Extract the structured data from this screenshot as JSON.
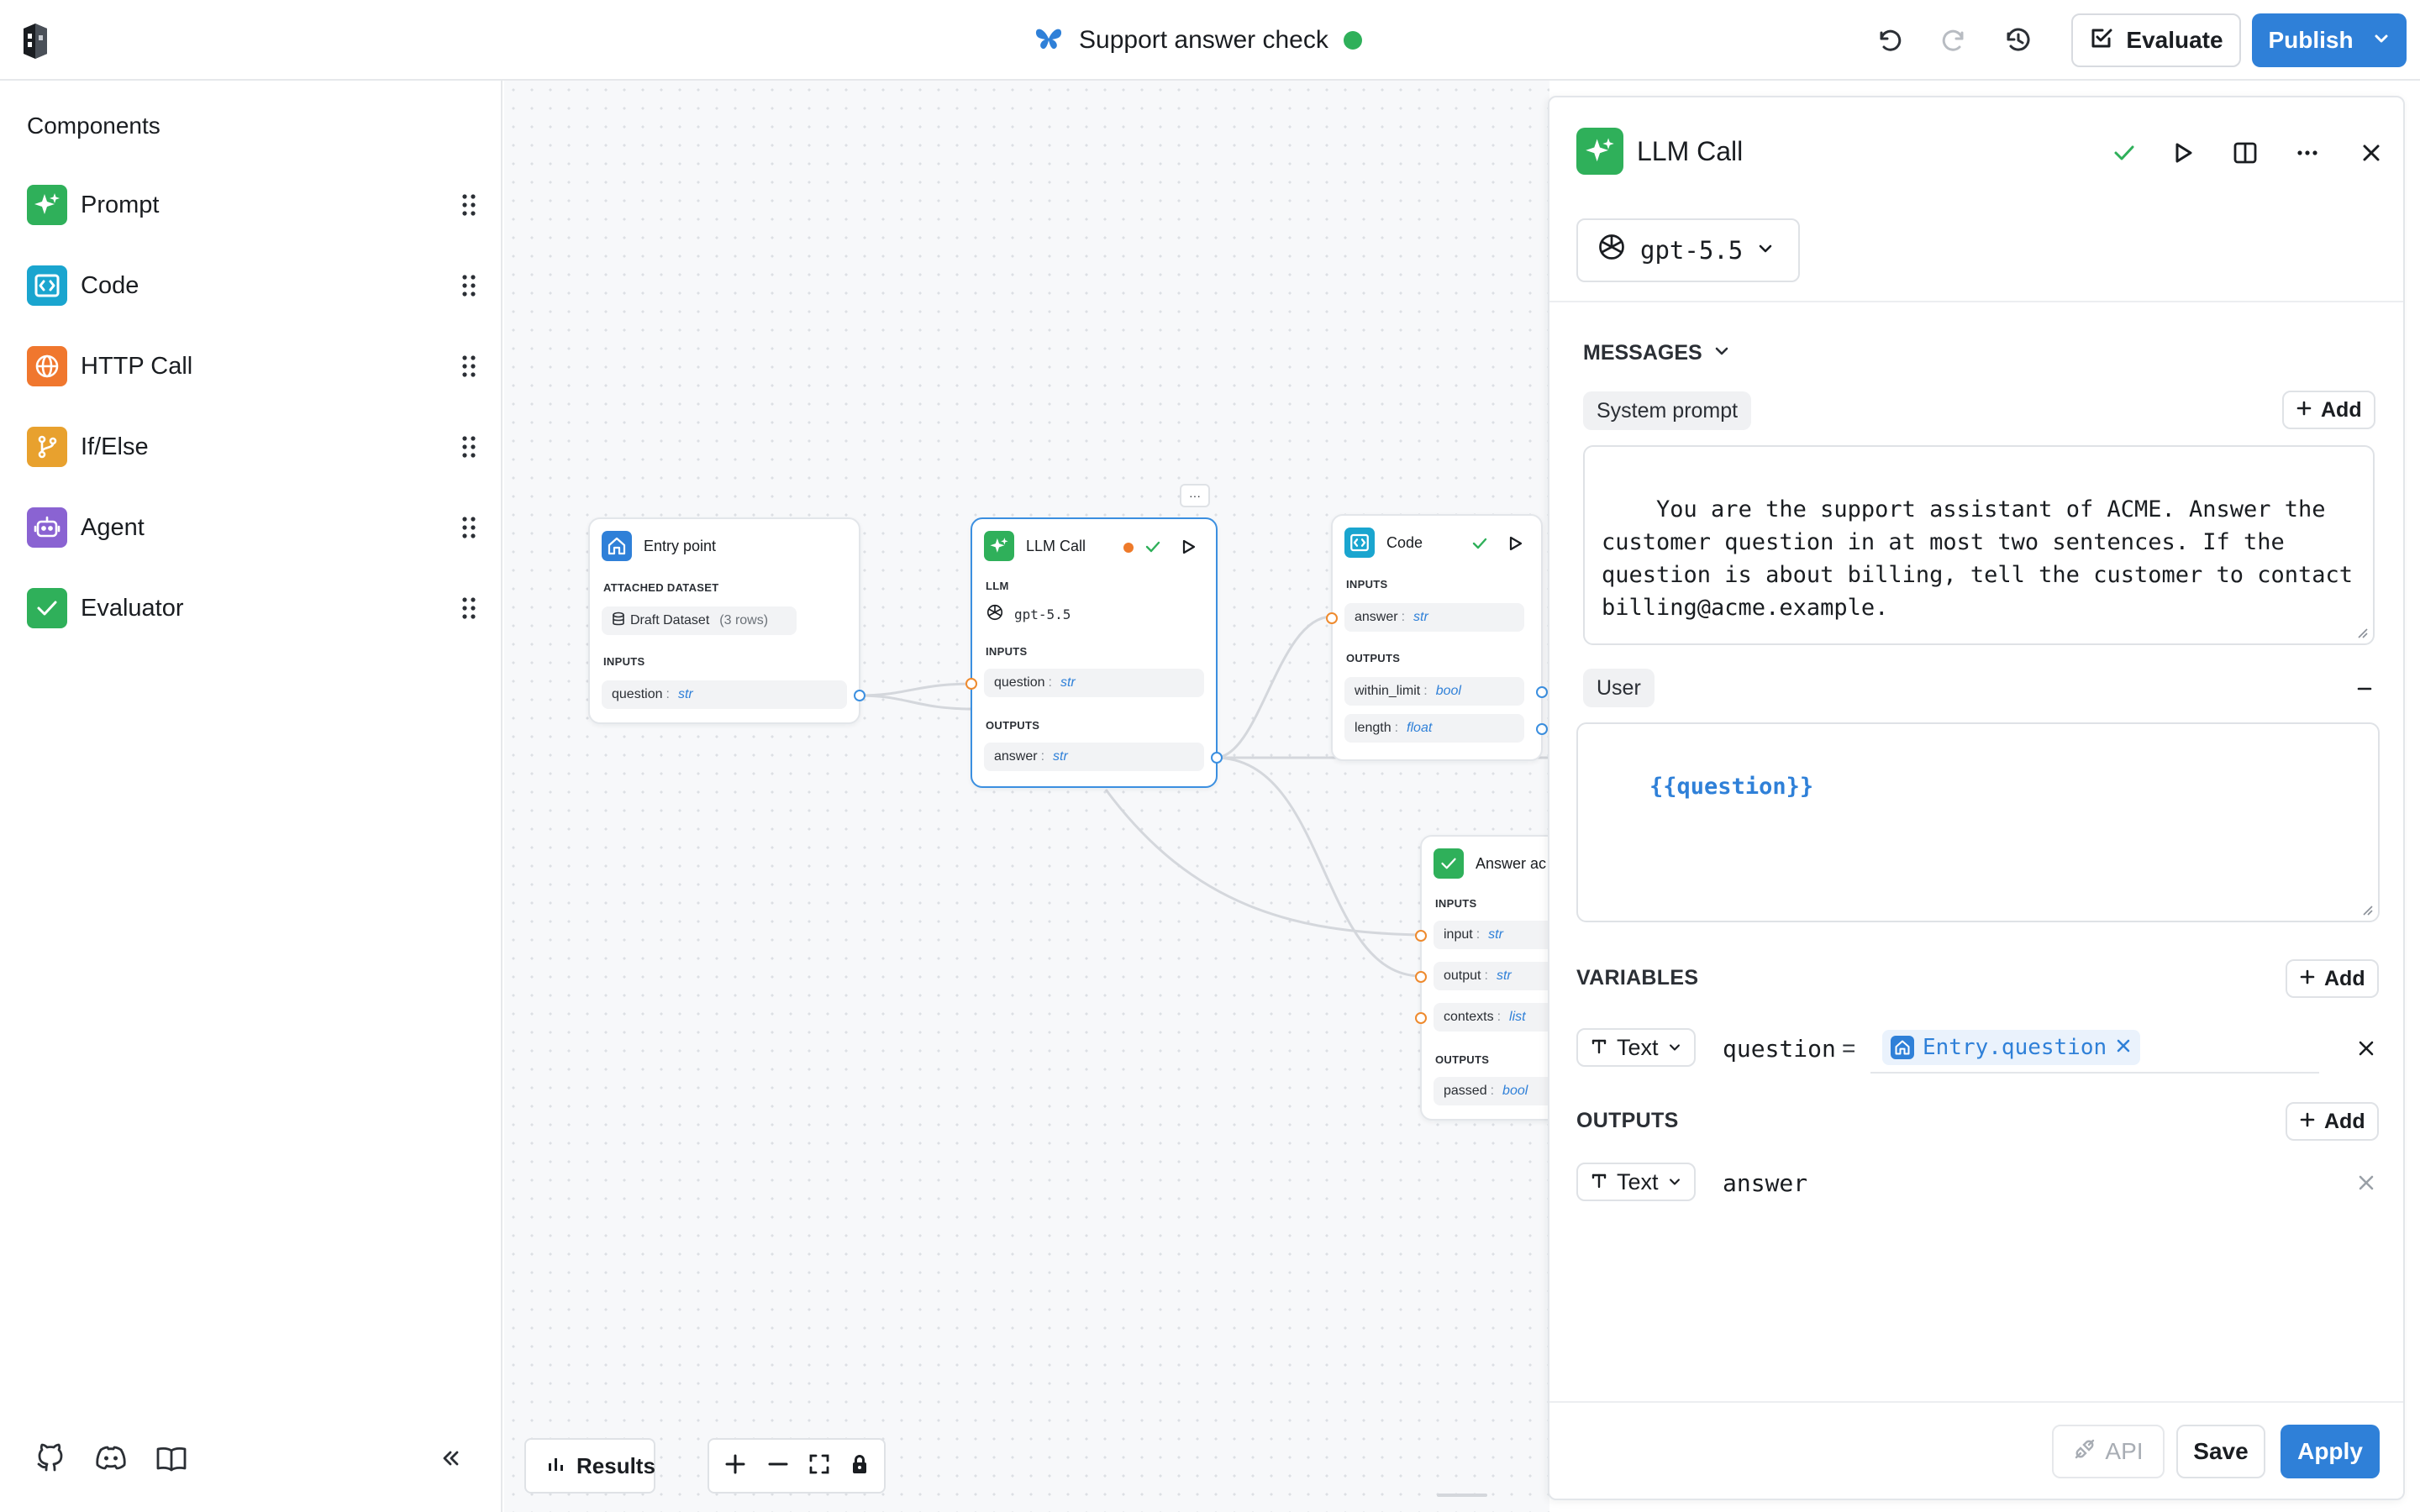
{
  "app": {
    "title": "Support answer check",
    "status_color": "#2fb05a",
    "accent": "#2f80d8"
  },
  "toolbar": {
    "icons": [
      "undo-icon",
      "redo-icon",
      "history-icon"
    ],
    "evaluate_label": "Evaluate",
    "publish_label": "Publish"
  },
  "sidebar": {
    "heading": "Components",
    "items": [
      {
        "label": "Prompt",
        "icon": "sparkle-icon",
        "color": "#2fb05a"
      },
      {
        "label": "Code",
        "icon": "code-icon",
        "color": "#1aa5cf"
      },
      {
        "label": "HTTP Call",
        "icon": "globe-icon",
        "color": "#f0772e"
      },
      {
        "label": "If/Else",
        "icon": "branch-icon",
        "color": "#e8a12e"
      },
      {
        "label": "Agent",
        "icon": "robot-icon",
        "color": "#8a63d2"
      },
      {
        "label": "Evaluator",
        "icon": "check-icon",
        "color": "#2fb05a"
      }
    ],
    "bottom_icons": [
      "github-icon",
      "discord-icon",
      "docs-icon",
      "collapse-icon"
    ]
  },
  "canvas": {
    "results_label": "Results",
    "entry_node": {
      "title": "Entry point",
      "dataset_section": "ATTACHED DATASET",
      "dataset_name": "Draft Dataset",
      "dataset_rows": "(3 rows)",
      "inputs_section": "INPUTS",
      "inputs": [
        {
          "name": "question",
          "type": "str"
        }
      ]
    },
    "llm_node": {
      "title": "LLM Call",
      "more_label": "···",
      "llm_section": "LLM",
      "model": "gpt-5.5",
      "inputs_section": "INPUTS",
      "inputs": [
        {
          "name": "question",
          "type": "str"
        }
      ],
      "outputs_section": "OUTPUTS",
      "outputs": [
        {
          "name": "answer",
          "type": "str"
        }
      ]
    },
    "code_node": {
      "title": "Code",
      "inputs_section": "INPUTS",
      "inputs": [
        {
          "name": "answer",
          "type": "str"
        }
      ],
      "outputs_section": "OUTPUTS",
      "outputs": [
        {
          "name": "within_limit",
          "type": "bool"
        },
        {
          "name": "length",
          "type": "float"
        }
      ]
    },
    "eval_node": {
      "title": "Answer ac",
      "inputs_section": "INPUTS",
      "inputs": [
        {
          "name": "input",
          "type": "str"
        },
        {
          "name": "output",
          "type": "str"
        },
        {
          "name": "contexts",
          "type": "list"
        }
      ],
      "outputs_section": "OUTPUTS",
      "outputs": [
        {
          "name": "passed",
          "type": "bool"
        }
      ]
    }
  },
  "panel": {
    "title": "LLM Call",
    "model": "gpt-5.5",
    "messages_label": "MESSAGES",
    "system_chip": "System prompt",
    "add_label": "Add",
    "system_text": "You are the support assistant of ACME. Answer the\ncustomer question in at most two sentences. If the\nquestion is about billing, tell the customer to contact\nbilling@acme.example.",
    "user_chip": "User",
    "user_text": "{{question}}",
    "variables_label": "VARIABLES",
    "variable": {
      "type": "Text",
      "name": "question",
      "equals": "=",
      "ref": "Entry.question"
    },
    "outputs_label": "OUTPUTS",
    "output": {
      "type": "Text",
      "name": "answer"
    },
    "api_label": "API",
    "save_label": "Save",
    "apply_label": "Apply"
  }
}
